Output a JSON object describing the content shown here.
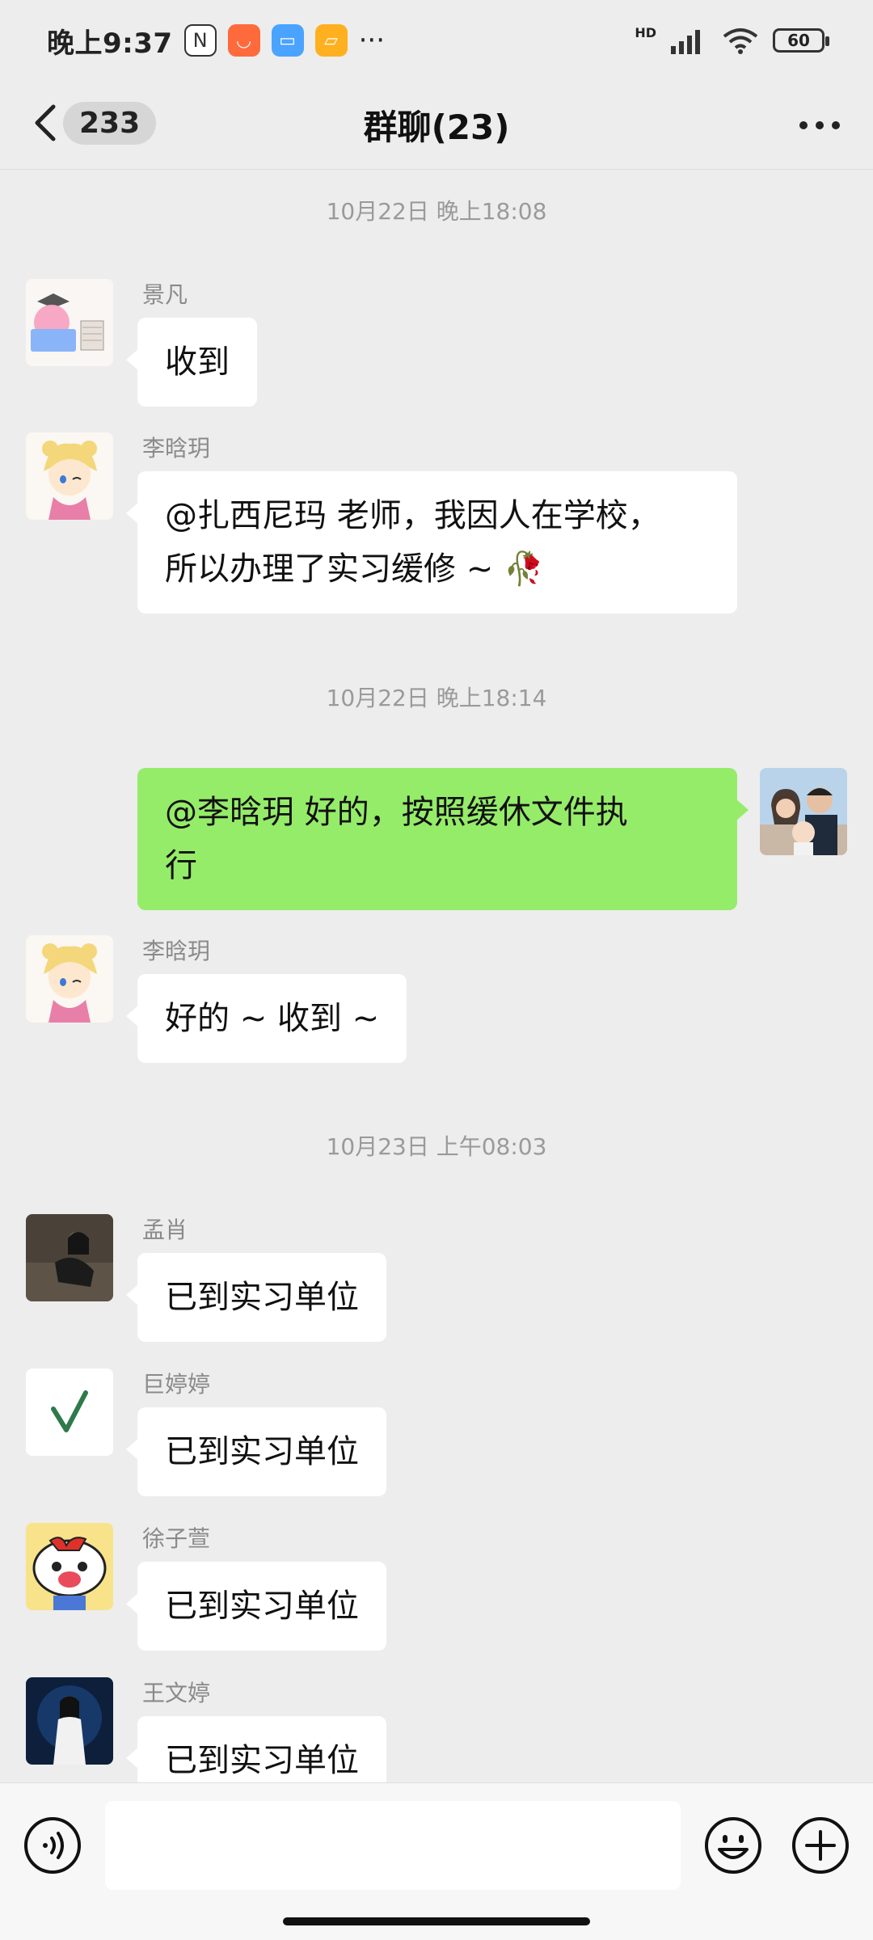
{
  "status_bar": {
    "time": "晚上9:37",
    "dots": "···",
    "battery": "60",
    "network": "HD"
  },
  "header": {
    "unread_count": "233",
    "title": "群聊(23)"
  },
  "timestamps": [
    "10月22日 晚上18:08",
    "10月22日 晚上18:14",
    "10月23日 上午08:03"
  ],
  "messages": [
    {
      "sender": "景凡",
      "text": "收到"
    },
    {
      "sender": "李晗玥",
      "line1": "@扎西尼玛  老师，我因人在学校，",
      "line2": "所以办理了实习缓修 ~",
      "emoji": "🥀"
    },
    {
      "sender": "",
      "line1": "@李晗玥  好的，按照缓休文件执",
      "line2": "行"
    },
    {
      "sender": "李晗玥",
      "text": "好的 ~ 收到 ~"
    },
    {
      "sender": "孟肖",
      "text": "已到实习单位"
    },
    {
      "sender": "巨婷婷",
      "text": "已到实习单位"
    },
    {
      "sender": "徐子萱",
      "text": "已到实习单位"
    },
    {
      "sender": "王文婷",
      "text": "已到实习单位"
    }
  ],
  "colors": {
    "background": "#ededed",
    "self_bubble": "#95ec69",
    "other_bubble": "#ffffff"
  },
  "icons": [
    "back-chevron-icon",
    "more-icon",
    "voice-icon",
    "emoji-icon",
    "add-icon",
    "wifi-icon",
    "signal-icon",
    "battery-icon"
  ]
}
